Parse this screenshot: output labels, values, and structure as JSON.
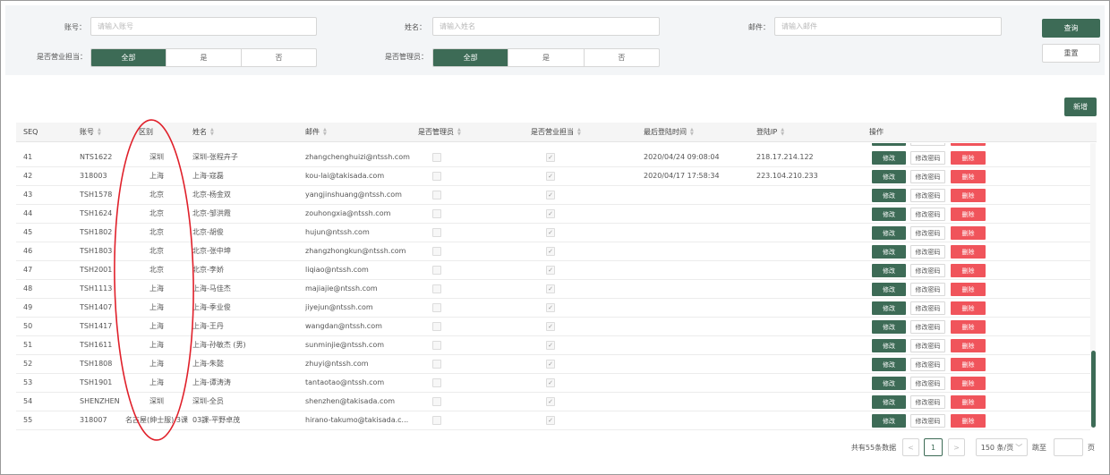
{
  "filters": {
    "account": {
      "label": "账号：",
      "placeholder": "请输入账号",
      "value": ""
    },
    "name": {
      "label": "姓名：",
      "placeholder": "请输入姓名",
      "value": ""
    },
    "email": {
      "label": "邮件：",
      "placeholder": "请输入邮件",
      "value": ""
    },
    "sales": {
      "label": "是否营业担当：",
      "options": [
        "全部",
        "是",
        "否"
      ],
      "selected": "全部"
    },
    "admin": {
      "label": "是否管理员：",
      "options": [
        "全部",
        "是",
        "否"
      ],
      "selected": "全部"
    },
    "query_label": "查询",
    "reset_label": "重置"
  },
  "toolbar": {
    "new_label": "新增"
  },
  "table": {
    "columns": {
      "seq": "SEQ",
      "account": "账号",
      "region": "区别",
      "name": "姓名",
      "email": "邮件",
      "is_admin": "是否管理员",
      "is_sales": "是否营业担当",
      "last_login": "最后登陆时间",
      "login_ip": "登陆IP",
      "actions": "操作"
    },
    "action_labels": {
      "edit": "修改",
      "password": "修改密码",
      "delete": "删除"
    },
    "rows": [
      {
        "seq": "41",
        "account": "NTS1622",
        "region": "深圳",
        "name": "深圳-张程卉子",
        "email": "zhangchenghuizi@ntssh.com",
        "is_admin": false,
        "is_sales": true,
        "last_login": "2020/04/24 09:08:04",
        "login_ip": "218.17.214.122"
      },
      {
        "seq": "42",
        "account": "318003",
        "region": "上海",
        "name": "上海-寇磊",
        "email": "kou-lai@takisada.com",
        "is_admin": false,
        "is_sales": true,
        "last_login": "2020/04/17 17:58:34",
        "login_ip": "223.104.210.233"
      },
      {
        "seq": "43",
        "account": "TSH1578",
        "region": "北京",
        "name": "北京-杨金双",
        "email": "yangjinshuang@ntssh.com",
        "is_admin": false,
        "is_sales": true,
        "last_login": "",
        "login_ip": ""
      },
      {
        "seq": "44",
        "account": "TSH1624",
        "region": "北京",
        "name": "北京-邹洪霞",
        "email": "zouhongxia@ntssh.com",
        "is_admin": false,
        "is_sales": true,
        "last_login": "",
        "login_ip": ""
      },
      {
        "seq": "45",
        "account": "TSH1802",
        "region": "北京",
        "name": "北京-胡俊",
        "email": "hujun@ntssh.com",
        "is_admin": false,
        "is_sales": true,
        "last_login": "",
        "login_ip": ""
      },
      {
        "seq": "46",
        "account": "TSH1803",
        "region": "北京",
        "name": "北京-张中坤",
        "email": "zhangzhongkun@ntssh.com",
        "is_admin": false,
        "is_sales": true,
        "last_login": "",
        "login_ip": ""
      },
      {
        "seq": "47",
        "account": "TSH2001",
        "region": "北京",
        "name": "北京-李娇",
        "email": "liqiao@ntssh.com",
        "is_admin": false,
        "is_sales": true,
        "last_login": "",
        "login_ip": ""
      },
      {
        "seq": "48",
        "account": "TSH1113",
        "region": "上海",
        "name": "上海-马佳杰",
        "email": "majiajie@ntssh.com",
        "is_admin": false,
        "is_sales": true,
        "last_login": "",
        "login_ip": ""
      },
      {
        "seq": "49",
        "account": "TSH1407",
        "region": "上海",
        "name": "上海-季业俊",
        "email": "jiyejun@ntssh.com",
        "is_admin": false,
        "is_sales": true,
        "last_login": "",
        "login_ip": ""
      },
      {
        "seq": "50",
        "account": "TSH1417",
        "region": "上海",
        "name": "上海-王丹",
        "email": "wangdan@ntssh.com",
        "is_admin": false,
        "is_sales": true,
        "last_login": "",
        "login_ip": ""
      },
      {
        "seq": "51",
        "account": "TSH1611",
        "region": "上海",
        "name": "上海-孙敏杰 (男)",
        "email": "sunminjie@ntssh.com",
        "is_admin": false,
        "is_sales": true,
        "last_login": "",
        "login_ip": ""
      },
      {
        "seq": "52",
        "account": "TSH1808",
        "region": "上海",
        "name": "上海-朱懿",
        "email": "zhuyi@ntssh.com",
        "is_admin": false,
        "is_sales": true,
        "last_login": "",
        "login_ip": ""
      },
      {
        "seq": "53",
        "account": "TSH1901",
        "region": "上海",
        "name": "上海-谭涛涛",
        "email": "tantaotao@ntssh.com",
        "is_admin": false,
        "is_sales": true,
        "last_login": "",
        "login_ip": ""
      },
      {
        "seq": "54",
        "account": "SHENZHEN",
        "region": "深圳",
        "name": "深圳-全员",
        "email": "shenzhen@takisada.com",
        "is_admin": false,
        "is_sales": true,
        "last_login": "",
        "login_ip": ""
      },
      {
        "seq": "55",
        "account": "318007",
        "region": "名古屋(绅士服)/3课",
        "name": "03課-平野卓茂",
        "email": "hirano-takumo@takisada.c...",
        "is_admin": false,
        "is_sales": true,
        "last_login": "",
        "login_ip": ""
      }
    ]
  },
  "pagination": {
    "total_text": "共有55条数据",
    "prev": "<",
    "current_page": "1",
    "next": ">",
    "page_size": "150 条/页",
    "jump_label": "跳至",
    "jump_value": "",
    "page_unit": "页"
  },
  "colors": {
    "primary": "#3d6b56",
    "danger": "#f0545b",
    "annotation": "#e0202a"
  }
}
